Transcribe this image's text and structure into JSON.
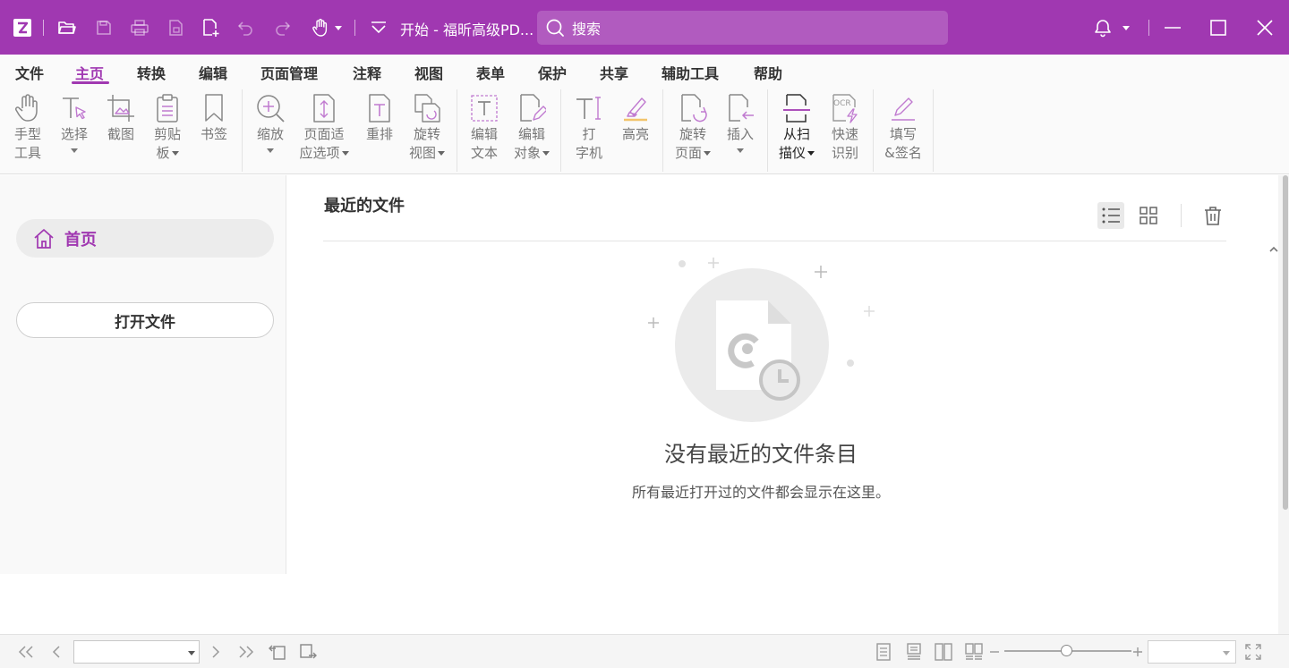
{
  "app": {
    "title": "开始 - 福昕高级PD...",
    "search_placeholder": "搜索",
    "brand_color": "#a038b1"
  },
  "menu": [
    "文件",
    "主页",
    "转换",
    "编辑",
    "页面管理",
    "注释",
    "视图",
    "表单",
    "保护",
    "共享",
    "辅助工具",
    "帮助"
  ],
  "menu_active": "主页",
  "ribbon": {
    "hand": [
      "手型",
      "工具"
    ],
    "select": [
      "选择"
    ],
    "snapshot": [
      "截图"
    ],
    "clipboard": [
      "剪贴",
      "板"
    ],
    "bookmark": [
      "书签"
    ],
    "zoom": [
      "缩放"
    ],
    "fit_page": [
      "页面适",
      "应选项"
    ],
    "reflow": [
      "重排"
    ],
    "rotate_view": [
      "旋转",
      "视图"
    ],
    "edit_text": [
      "编辑",
      "文本"
    ],
    "edit_object": [
      "编辑",
      "对象"
    ],
    "typewriter": [
      "打",
      "字机"
    ],
    "highlight": [
      "高亮"
    ],
    "rotate_page": [
      "旋转",
      "页面"
    ],
    "insert": [
      "插入"
    ],
    "scan": [
      "从扫",
      "描仪"
    ],
    "ocr": [
      "快速",
      "识别"
    ],
    "ocr_icon_text": "OCR",
    "fill_sign": [
      "填写",
      "&签名"
    ]
  },
  "sidebar": {
    "home_label": "首页",
    "open_file_label": "打开文件"
  },
  "main": {
    "title": "最近的文件",
    "empty_title": "没有最近的文件条目",
    "empty_subtitle": "所有最近打开过的文件都会显示在这里。"
  }
}
